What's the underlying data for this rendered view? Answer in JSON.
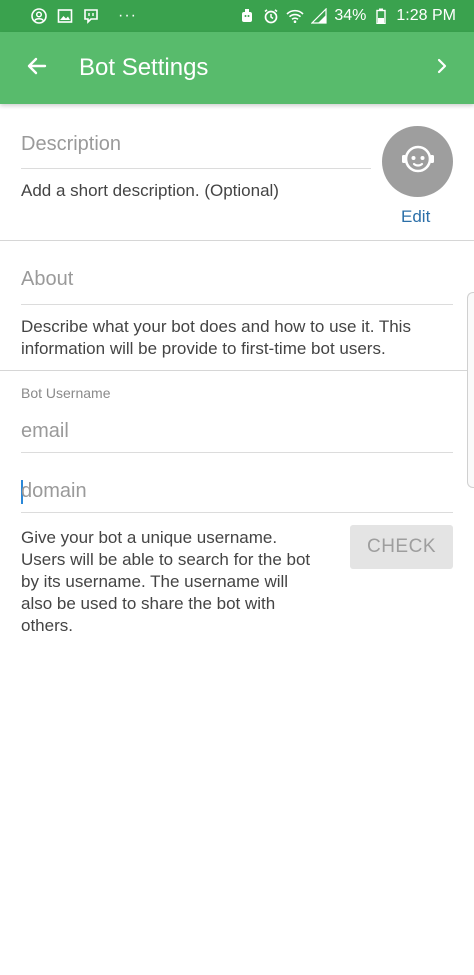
{
  "status_bar": {
    "battery": "34%",
    "time": "1:28 PM",
    "icons": [
      "account-circle-icon",
      "image-icon",
      "message-icon",
      "more-dots-icon",
      "android-icon",
      "alarm-icon",
      "wifi-icon",
      "signal-icon",
      "battery-icon"
    ]
  },
  "app_bar": {
    "title": "Bot Settings",
    "back_icon": "arrow-left-icon",
    "next_icon": "chevron-right-icon",
    "color": "#58bb6c"
  },
  "description": {
    "placeholder": "Description",
    "hint": "Add a short description. (Optional)",
    "edit_label": "Edit",
    "avatar_icon": "bot-face-icon"
  },
  "about": {
    "placeholder": "About",
    "hint": "Describe what your bot does and how to use it. This information will be provide to first-time bot users."
  },
  "username": {
    "label": "Bot Username",
    "email_placeholder": "email",
    "domain_placeholder": "domain",
    "hint": "Give your bot a unique username. Users will be able to search for the bot by its username. The username will also be used to share the bot with others.",
    "check_label": "CHECK"
  }
}
